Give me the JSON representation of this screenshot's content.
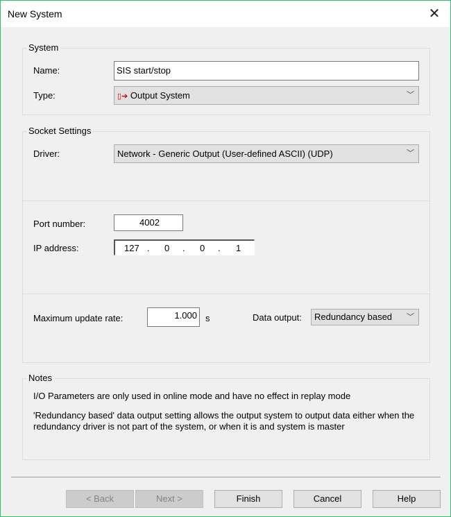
{
  "window": {
    "title": "New System"
  },
  "system": {
    "legend": "System",
    "name_label": "Name:",
    "name_value": "SIS start/stop",
    "type_label": "Type:",
    "type_value": "Output System"
  },
  "socket": {
    "legend": "Socket Settings",
    "driver_label": "Driver:",
    "driver_value": "Network - Generic Output (User-defined ASCII) (UDP)",
    "port_label": "Port number:",
    "port_value": "4002",
    "ip_label": "IP address:",
    "ip": [
      "127",
      "0",
      "0",
      "1"
    ],
    "rate_label": "Maximum update rate:",
    "rate_value": "1.000",
    "rate_unit": "s",
    "output_label": "Data output:",
    "output_value": "Redundancy based"
  },
  "notes": {
    "legend": "Notes",
    "line1": "I/O Parameters are only used in online mode and have no effect in replay mode",
    "line2": "'Redundancy based' data output setting allows the output system to output data either when the redundancy driver is not part of the system, or when it is and system is master"
  },
  "buttons": {
    "back": "< Back",
    "next": "Next >",
    "finish": "Finish",
    "cancel": "Cancel",
    "help": "Help"
  }
}
